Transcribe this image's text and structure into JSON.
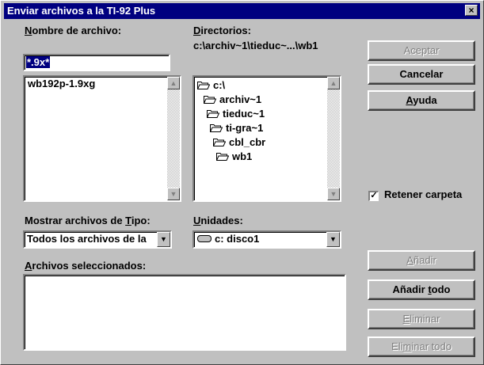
{
  "window": {
    "title": "Enviar archivos a la TI-92 Plus",
    "close": "×"
  },
  "file_name": {
    "label_ul": "N",
    "label_rest": "ombre de archivo:",
    "value": "*.9x*",
    "files": [
      "wb192p-1.9xg"
    ]
  },
  "directories": {
    "label_ul": "D",
    "label_rest": "irectorios:",
    "path": "c:\\archiv~1\\tieduc~...\\wb1",
    "tree": [
      "c:\\",
      "archiv~1",
      "tieduc~1",
      "ti-gra~1",
      "cbl_cbr",
      "wb1"
    ]
  },
  "file_type": {
    "label_pre": "Mostrar archivos de ",
    "label_ul": "T",
    "label_rest": "ipo:",
    "value": "Todos los archivos de la"
  },
  "drives": {
    "label_ul": "U",
    "label_rest": "nidades:",
    "value": "c: disco1"
  },
  "selected": {
    "label_ul": "A",
    "label_rest": "rchivos seleccionados:"
  },
  "buttons": {
    "accept": "Aceptar",
    "cancel": "Cancelar",
    "help_ul": "A",
    "help_rest": "yuda",
    "add_ul": "A",
    "add_rest": "ñadir",
    "add_all_pre": "Añadir ",
    "add_all_ul": "t",
    "add_all_rest": "odo",
    "remove_ul": "E",
    "remove_rest": "liminar",
    "remove_all_pre": "Eli",
    "remove_all_ul": "m",
    "remove_all_rest": "inar todo"
  },
  "retain_folder": {
    "label": "Retener carpeta",
    "checked": true,
    "mark": "✓"
  },
  "scroll_up": "▲",
  "scroll_down": "▼",
  "dropdown_arrow": "▼"
}
